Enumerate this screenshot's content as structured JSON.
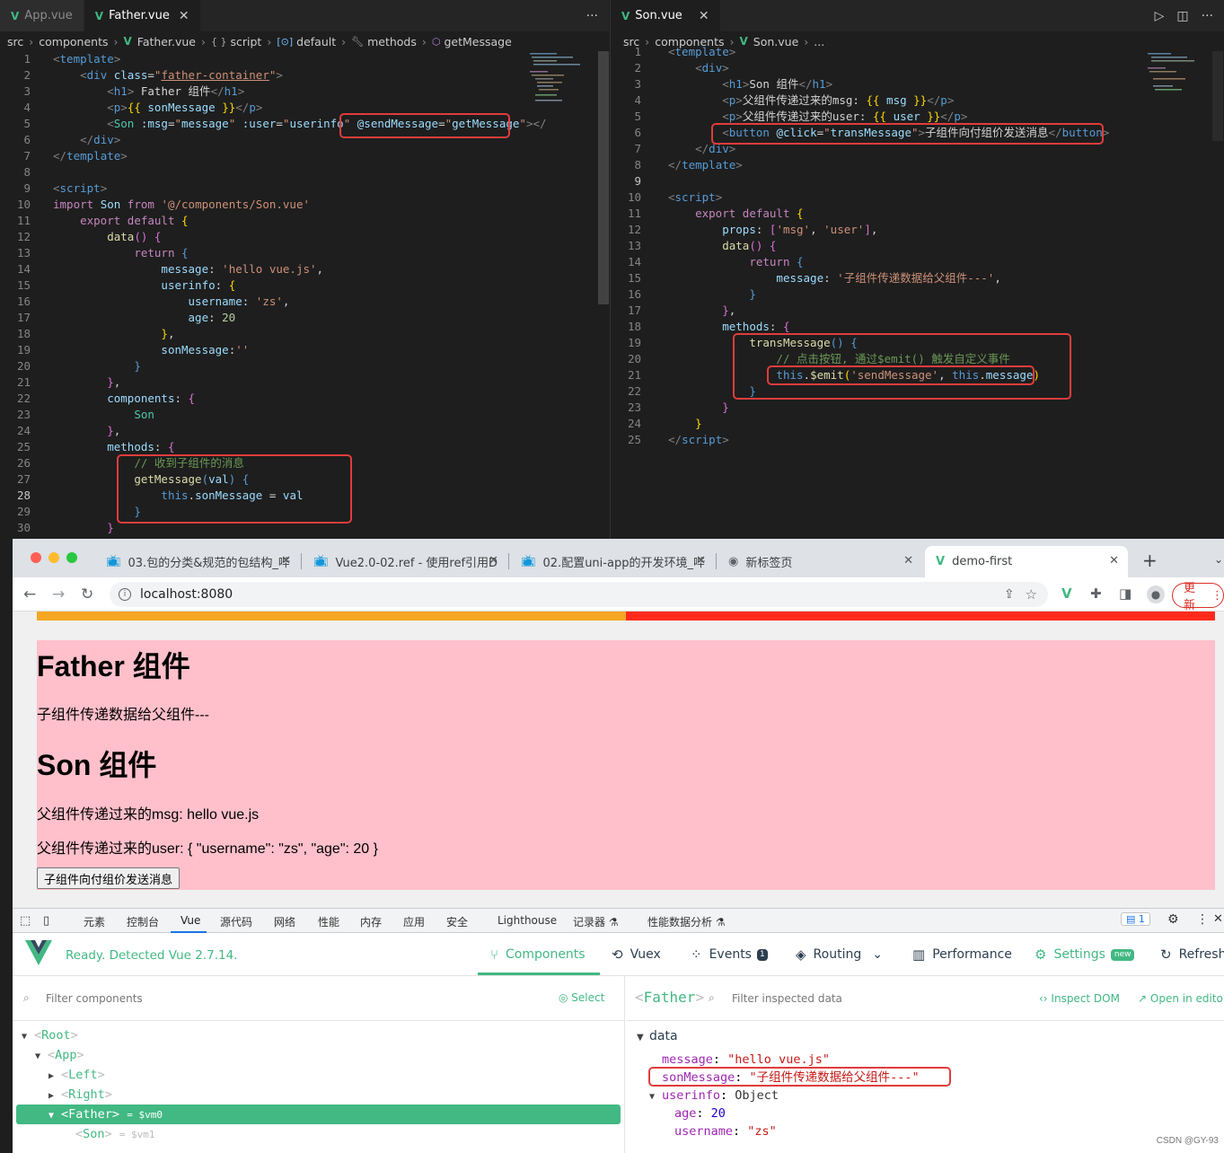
{
  "left_editor": {
    "tabs": [
      {
        "label": "App.vue",
        "active": false
      },
      {
        "label": "Father.vue",
        "active": true
      }
    ],
    "more": "···",
    "breadcrumb": {
      "src": "src",
      "components": "components",
      "file": "Father.vue",
      "script": "script",
      "default": "default",
      "methods": "methods",
      "method": "getMessage",
      "script_icon": "{ }",
      "default_icon": "[⊙]"
    },
    "lines": [
      {
        "n": "1",
        "html": "<span class='tp'>&lt;</span><span class='tg'>template</span><span class='tp'>&gt;</span>"
      },
      {
        "n": "2",
        "html": "    <span class='tp'>&lt;</span><span class='tg'>div</span> <span class='ta'>class</span><span class='tt'>=</span><span class='ts'>\"<u>father-container</u>\"</span><span class='tp'>&gt;</span>"
      },
      {
        "n": "3",
        "html": "        <span class='tp'>&lt;</span><span class='tg'>h1</span><span class='tp'>&gt;</span><span class='tt'> Father 组件</span><span class='tp'>&lt;/</span><span class='tg'>h1</span><span class='tp'>&gt;</span>"
      },
      {
        "n": "4",
        "html": "        <span class='tp'>&lt;</span><span class='tg'>p</span><span class='tp'>&gt;</span><span class='tb'>{{</span> <span class='ta'>sonMessage</span> <span class='tb'>}}</span><span class='tp'>&lt;/</span><span class='tg'>p</span><span class='tp'>&gt;</span>"
      },
      {
        "n": "5",
        "html": "        <span class='tp'>&lt;</span><span class='tn'>Son</span> <span class='ta'>:msg</span><span class='tt'>=</span><span class='ts'>\"</span><span class='ta'>message</span><span class='ts'>\"</span> <span class='ta'>:user</span><span class='tt'>=</span><span class='ts'>\"</span><span class='ta'>userinfo</span><span class='ts'>\"</span> <span class='ta'>@sendMessage</span><span class='tt'>=</span><span class='ts'>\"</span><span class='ta'>getMessage</span><span class='ts'>\"</span><span class='tp'>&gt;&lt;/</span>"
      },
      {
        "n": "6",
        "html": "    <span class='tp'>&lt;/</span><span class='tg'>div</span><span class='tp'>&gt;</span>"
      },
      {
        "n": "7",
        "html": "<span class='tp'>&lt;/</span><span class='tg'>template</span><span class='tp'>&gt;</span>"
      },
      {
        "n": "8",
        "html": ""
      },
      {
        "n": "9",
        "html": "<span class='tp'>&lt;</span><span class='tg'>script</span><span class='tp'>&gt;</span>"
      },
      {
        "n": "10",
        "html": "<span class='tk'>import</span> <span class='ta'>Son</span> <span class='tk'>from</span> <span class='ts'>'@/components/Son.vue'</span>"
      },
      {
        "n": "11",
        "html": "    <span class='tk'>export</span> <span class='tk'>default</span> <span class='tb'>{</span>"
      },
      {
        "n": "12",
        "html": "        <span class='tf'>data</span><span class='tm'>()</span> <span class='tm'>{</span>"
      },
      {
        "n": "13",
        "html": "            <span class='tk'>return</span> <span class='kw'>{</span>"
      },
      {
        "n": "14",
        "html": "                <span class='ta'>message</span><span class='tt'>: </span><span class='ts'>'hello vue.js'</span><span class='tt'>,</span>"
      },
      {
        "n": "15",
        "html": "                <span class='ta'>userinfo</span><span class='tt'>: </span><span class='tb'>{</span>"
      },
      {
        "n": "16",
        "html": "                    <span class='ta'>username</span><span class='tt'>: </span><span class='ts'>'zs'</span><span class='tt'>,</span>"
      },
      {
        "n": "17",
        "html": "                    <span class='ta'>age</span><span class='tt'>: </span><span class='tnum'>20</span>"
      },
      {
        "n": "18",
        "html": "                <span class='tb'>}</span><span class='tt'>,</span>"
      },
      {
        "n": "19",
        "html": "                <span class='ta'>sonMessage</span><span class='tt'>:</span><span class='ts'>''</span>"
      },
      {
        "n": "20",
        "html": "            <span class='kw'>}</span>"
      },
      {
        "n": "21",
        "html": "        <span class='tm'>}</span><span class='tt'>,</span>"
      },
      {
        "n": "22",
        "html": "        <span class='ta'>components</span><span class='tt'>: </span><span class='tm'>{</span>"
      },
      {
        "n": "23",
        "html": "            <span class='tn'>Son</span>"
      },
      {
        "n": "24",
        "html": "        <span class='tm'>}</span><span class='tt'>,</span>"
      },
      {
        "n": "25",
        "html": "        <span class='ta'>methods</span><span class='tt'>: </span><span class='tm'>{</span>"
      },
      {
        "n": "26",
        "html": "            <span class='tc'>// 收到子组件的消息</span>"
      },
      {
        "n": "27",
        "html": "            <span class='tf'>getMessage</span><span class='kw'>(</span><span class='ta'>val</span><span class='kw'>)</span> <span class='kw'>{</span>"
      },
      {
        "n": "28",
        "html": "                <span class='kw'>this</span><span class='tt'>.</span><span class='ta'>sonMessage</span> <span class='tt'>=</span> <span class='ta'>val</span>"
      },
      {
        "n": "29",
        "html": "            <span class='kw'>}</span>"
      },
      {
        "n": "30",
        "html": "        <span class='tm'>}</span>"
      }
    ]
  },
  "right_editor": {
    "tabs": [
      {
        "label": "Son.vue",
        "active": true
      }
    ],
    "breadcrumb": {
      "src": "src",
      "components": "components",
      "file": "Son.vue",
      "rest": "..."
    },
    "actions": [
      "▷",
      "◫",
      "···"
    ],
    "lines": [
      {
        "n": "1",
        "html": "<span class='tp'>&lt;</span><span class='tg'>template</span><span class='tp'>&gt;</span>"
      },
      {
        "n": "2",
        "html": "    <span class='tp'>&lt;</span><span class='tg'>div</span><span class='tp'>&gt;</span>"
      },
      {
        "n": "3",
        "html": "        <span class='tp'>&lt;</span><span class='tg'>h1</span><span class='tp'>&gt;</span><span class='tt'>Son 组件</span><span class='tp'>&lt;/</span><span class='tg'>h1</span><span class='tp'>&gt;</span>"
      },
      {
        "n": "4",
        "html": "        <span class='tp'>&lt;</span><span class='tg'>p</span><span class='tp'>&gt;</span><span class='tt'>父组件传递过来的msg: </span><span class='tb'>{{</span> <span class='ta'>msg</span> <span class='tb'>}}</span><span class='tp'>&lt;/</span><span class='tg'>p</span><span class='tp'>&gt;</span>"
      },
      {
        "n": "5",
        "html": "        <span class='tp'>&lt;</span><span class='tg'>p</span><span class='tp'>&gt;</span><span class='tt'>父组件传递过来的user: </span><span class='tb'>{{</span> <span class='ta'>user</span> <span class='tb'>}}</span><span class='tp'>&lt;/</span><span class='tg'>p</span><span class='tp'>&gt;</span>"
      },
      {
        "n": "6",
        "html": "        <span class='tp'>&lt;</span><span class='tg'>button</span> <span class='ta'>@click</span><span class='tt'>=</span><span class='ts'>\"</span><span class='ta'>transMessage</span><span class='ts'>\"</span><span class='tp'>&gt;</span><span class='tt'>子组件向付组价发送消息</span><span class='tp'>&lt;/</span><span class='tg'>button</span><span class='tp'>&gt;</span>"
      },
      {
        "n": "7",
        "html": "    <span class='tp'>&lt;/</span><span class='tg'>div</span><span class='tp'>&gt;</span>"
      },
      {
        "n": "8",
        "html": "<span class='tp'>&lt;/</span><span class='tg'>template</span><span class='tp'>&gt;</span>"
      },
      {
        "n": "9",
        "html": ""
      },
      {
        "n": "10",
        "html": "<span class='tp'>&lt;</span><span class='tg'>script</span><span class='tp'>&gt;</span>"
      },
      {
        "n": "11",
        "html": "    <span class='tk'>export</span> <span class='tk'>default</span> <span class='tb'>{</span>"
      },
      {
        "n": "12",
        "html": "        <span class='ta'>props</span><span class='tt'>: </span><span class='tm'>[</span><span class='ts'>'msg'</span><span class='tt'>, </span><span class='ts'>'user'</span><span class='tm'>]</span><span class='tt'>,</span>"
      },
      {
        "n": "13",
        "html": "        <span class='tf'>data</span><span class='tm'>()</span> <span class='tm'>{</span>"
      },
      {
        "n": "14",
        "html": "            <span class='tk'>return</span> <span class='kw'>{</span>"
      },
      {
        "n": "15",
        "html": "                <span class='ta'>message</span><span class='tt'>: </span><span class='ts'>'子组件传递数据给父组件---'</span><span class='tt'>,</span>"
      },
      {
        "n": "16",
        "html": "            <span class='kw'>}</span>"
      },
      {
        "n": "17",
        "html": "        <span class='tm'>}</span><span class='tt'>,</span>"
      },
      {
        "n": "18",
        "html": "        <span class='ta'>methods</span><span class='tt'>: </span><span class='tm'>{</span>"
      },
      {
        "n": "19",
        "html": "            <span class='tf'>transMessage</span><span class='kw'>()</span> <span class='kw'>{</span>"
      },
      {
        "n": "20",
        "html": "                <span class='tc'>// 点击按钮, 通过$emit() 触发自定义事件</span>"
      },
      {
        "n": "21",
        "html": "                <span class='kw'>this</span><span class='tt'>.</span><span class='tf'>$emit</span><span class='tb'>(</span><span class='ts'>'sendMessage'</span><span class='tt'>, </span><span class='kw'>this</span><span class='tt'>.</span><span class='ta'>message</span><span class='tb'>)</span>"
      },
      {
        "n": "22",
        "html": "            <span class='kw'>}</span>"
      },
      {
        "n": "23",
        "html": "        <span class='tm'>}</span>"
      },
      {
        "n": "24",
        "html": "    <span class='tb'>}</span>"
      },
      {
        "n": "25",
        "html": "<span class='tp'>&lt;/</span><span class='tg'>script</span><span class='tp'>&gt;</span>"
      }
    ]
  },
  "browser": {
    "tabs": [
      {
        "label": "03.包的分类&规范的包结构_哔",
        "icon": "bilibili-icon"
      },
      {
        "label": "Vue2.0-02.ref - 使用ref引用D",
        "icon": "bilibili-icon"
      },
      {
        "label": "02.配置uni-app的开发环境_哔",
        "icon": "bilibili-icon"
      },
      {
        "label": "新标签页",
        "icon": "chrome-icon"
      },
      {
        "label": "demo-first",
        "icon": "vue-icon",
        "active": true
      }
    ],
    "new_tab": "+",
    "url": "localhost:8080",
    "update_label": "更新",
    "page": {
      "father_title": "Father 组件",
      "son_message": "子组件传递数据给父组件---",
      "son_title": "Son 组件",
      "msg_line": "父组件传递过来的msg: hello vue.js",
      "user_line": "父组件传递过来的user: { \"username\": \"zs\", \"age\": 20 }",
      "button_label": "子组件向付组价发送消息"
    }
  },
  "devtools": {
    "tabs": [
      "元素",
      "控制台",
      "Vue",
      "源代码",
      "网络",
      "性能",
      "内存",
      "应用",
      "安全",
      "Lighthouse",
      "记录器 ⚗",
      "性能数据分析 ⚗"
    ],
    "active_tab": "Vue",
    "issues_count": "1",
    "vue": {
      "status": "Ready. Detected Vue 2.7.14.",
      "nav": {
        "components": "Components",
        "vuex": "Vuex",
        "events": "Events",
        "events_badge": "1",
        "routing": "Routing",
        "performance": "Performance",
        "settings": "Settings",
        "settings_badge": "new",
        "refresh": "Refresh"
      },
      "filter_placeholder": "Filter components",
      "select_label": "Select",
      "tree": {
        "root": "Root",
        "app": "App",
        "left": "Left",
        "right": "Right",
        "father": "Father",
        "father_vm": "= $vm0",
        "son": "Son",
        "son_vm": "= $vm1"
      },
      "inspector": {
        "component": "Father",
        "filter_placeholder": "Filter inspected data",
        "inspect_dom": "Inspect DOM",
        "open_in_editor": "Open in editor",
        "section": "data",
        "message_key": "message",
        "message_val": "\"hello vue.js\"",
        "sonmessage_key": "sonMessage",
        "sonmessage_val": "\"子组件传递数据给父组件---\"",
        "userinfo_key": "userinfo",
        "userinfo_val": "Object",
        "age_key": "age",
        "age_val": "20",
        "username_key": "username",
        "username_val": "\"zs\""
      }
    }
  },
  "watermark": "CSDN @GY-93",
  "colors": {
    "accent": "#42b883",
    "highlight_box": "#e03c3c",
    "father_bg": "#ffc0cb"
  }
}
